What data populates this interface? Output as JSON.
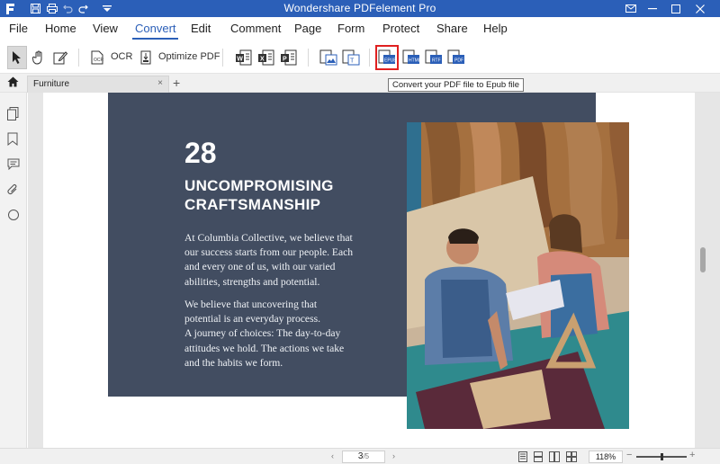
{
  "app": {
    "title": "Wondershare PDFelement Pro"
  },
  "menu": {
    "items": [
      "File",
      "Home",
      "View",
      "Convert",
      "Edit",
      "Comment",
      "Page",
      "Form",
      "Protect",
      "Share",
      "Help"
    ],
    "active": "Convert"
  },
  "toolbar": {
    "ocr_label": "OCR",
    "optimize_label": "Optimize PDF",
    "tooltip": "Convert your PDF file to Epub file",
    "highlighted_tool": "to-epub"
  },
  "tabs": {
    "items": [
      {
        "label": "Furniture",
        "close": "×"
      }
    ],
    "add": "+"
  },
  "document": {
    "number": "28",
    "headline_line1": "UNCOMPROMISING",
    "headline_line2": "CRAFTSMANSHIP",
    "para1_lines": [
      "At Columbia Collective, we believe that",
      "our success starts from our people. Each",
      "and every one of us, with our varied",
      "abilities, strengths and potential."
    ],
    "para2_lines": [
      "We believe that uncovering that",
      "potential is an everyday process.",
      "A journey of choices: The day-to-day",
      "attitudes we hold. The actions we take",
      "and the habits we form."
    ],
    "photo_alt": "Two craftspeople cutting leather patterns at a workbench"
  },
  "status": {
    "current_page": "3",
    "total_pages": "/5",
    "zoom": "118%",
    "zoom_level_fraction": 0.5,
    "prev": "‹",
    "next": "›",
    "zoom_out": "−",
    "zoom_in": "+"
  },
  "colors": {
    "accent": "#2b5fb8",
    "panel": "#424d61",
    "highlight_border": "#e02020"
  }
}
